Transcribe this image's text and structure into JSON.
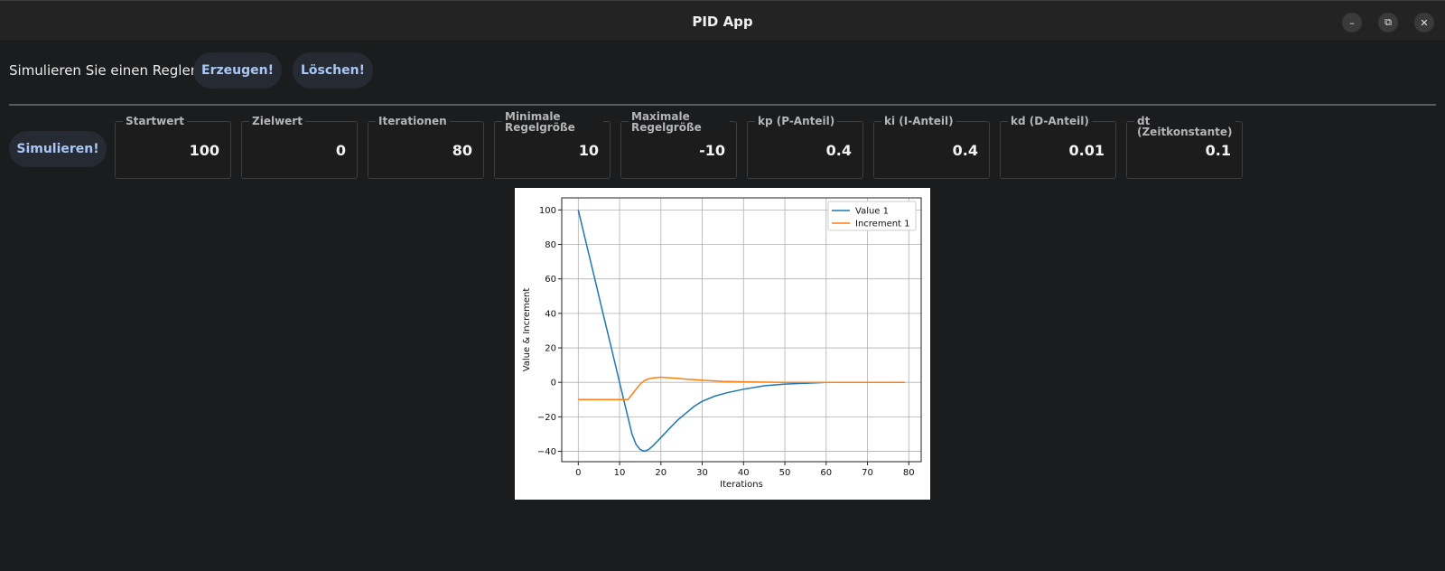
{
  "window": {
    "title": "PID App",
    "controls": {
      "minimize": "minimize-icon",
      "maximize": "maximize-icon",
      "close": "close-icon"
    }
  },
  "toolbar": {
    "label": "Simulieren Sie einen Regler:",
    "generate_label": "Erzeugen!",
    "delete_label": "Löschen!"
  },
  "params": {
    "simulate_label": "Simulieren!",
    "fields": [
      {
        "label": "Startwert",
        "value": "100"
      },
      {
        "label": "Zielwert",
        "value": "0"
      },
      {
        "label": "Iterationen",
        "value": "80"
      },
      {
        "label": "Minimale Regelgröße",
        "value": "10"
      },
      {
        "label": "Maximale Regelgröße",
        "value": "-10"
      },
      {
        "label": "kp (P-Anteil)",
        "value": "0.4"
      },
      {
        "label": "ki (I-Anteil)",
        "value": "0.4"
      },
      {
        "label": "kd (D-Anteil)",
        "value": "0.01"
      },
      {
        "label": "dt (Zeitkonstante)",
        "value": "0.1"
      }
    ]
  },
  "colors": {
    "accent": "#a9c7f5",
    "series1": "#1f77b4",
    "series2": "#ff7f0e"
  },
  "chart_data": {
    "type": "line",
    "xlabel": "Iterations",
    "ylabel": "Value & Increment",
    "xlim": [
      -4,
      83
    ],
    "ylim": [
      -46,
      107
    ],
    "xticks": [
      0,
      10,
      20,
      30,
      40,
      50,
      60,
      70,
      80
    ],
    "yticks": [
      -40,
      -20,
      0,
      20,
      40,
      60,
      80,
      100
    ],
    "grid": true,
    "legend_position": "top-right",
    "series": [
      {
        "name": "Value 1",
        "color": "#1f77b4",
        "points": [
          [
            0,
            100
          ],
          [
            2,
            80
          ],
          [
            4,
            60
          ],
          [
            6,
            40
          ],
          [
            8,
            20
          ],
          [
            10,
            0
          ],
          [
            11,
            -10
          ],
          [
            12,
            -20
          ],
          [
            13,
            -30
          ],
          [
            14,
            -36
          ],
          [
            15,
            -39
          ],
          [
            16,
            -40
          ],
          [
            17,
            -39
          ],
          [
            18,
            -37
          ],
          [
            20,
            -32
          ],
          [
            22,
            -27
          ],
          [
            24,
            -22
          ],
          [
            26,
            -18
          ],
          [
            28,
            -14
          ],
          [
            30,
            -11
          ],
          [
            33,
            -8
          ],
          [
            36,
            -6
          ],
          [
            40,
            -4
          ],
          [
            45,
            -2
          ],
          [
            50,
            -1
          ],
          [
            55,
            -0.5
          ],
          [
            60,
            0
          ],
          [
            70,
            0
          ],
          [
            79,
            0
          ]
        ]
      },
      {
        "name": "Increment 1",
        "color": "#ff7f0e",
        "points": [
          [
            0,
            -10
          ],
          [
            5,
            -10
          ],
          [
            10,
            -10
          ],
          [
            12,
            -10
          ],
          [
            13,
            -7
          ],
          [
            14,
            -4
          ],
          [
            15,
            -1
          ],
          [
            16,
            1
          ],
          [
            17,
            2
          ],
          [
            18,
            2.5
          ],
          [
            20,
            3
          ],
          [
            22,
            2.7
          ],
          [
            24,
            2.3
          ],
          [
            26,
            1.9
          ],
          [
            30,
            1.2
          ],
          [
            35,
            0.6
          ],
          [
            40,
            0.3
          ],
          [
            50,
            0
          ],
          [
            60,
            0
          ],
          [
            70,
            0
          ],
          [
            79,
            0
          ]
        ]
      }
    ]
  }
}
